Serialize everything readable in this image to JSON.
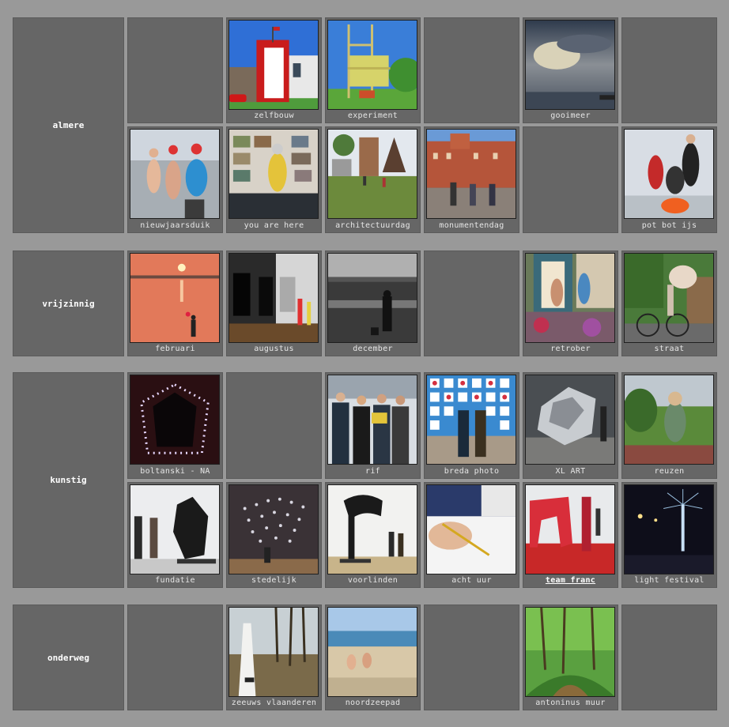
{
  "sections": [
    {
      "name": "almere"
    },
    {
      "name": "vrijzinnig"
    },
    {
      "name": "kunstig"
    },
    {
      "name": "onderweg"
    }
  ],
  "tiles": {
    "zelfbouw": "zelfbouw",
    "experiment": "experiment",
    "gooimeer": "gooimeer",
    "nieuwjaarsduik": "nieuwjaarsduik",
    "you_are_here": "you are here",
    "architectuurdag": "architectuurdag",
    "monumentendag": "monumentendag",
    "pot_bot_ijs": "pot bot ijs",
    "februari": "februari",
    "augustus": "augustus",
    "december": "december",
    "retrober": "retrober",
    "straat": "straat",
    "boltanski": "boltanski - NA",
    "rif": "rif",
    "breda_photo": "breda photo",
    "xl_art": "XL ART",
    "reuzen": "reuzen",
    "fundatie": "fundatie",
    "stedelijk": "stedelijk",
    "voorlinden": "voorlinden",
    "acht_uur": "acht uur",
    "team_franc": "team franc",
    "light_festival": "light festival",
    "zeeuws_vlaanderen": "zeeuws vlaanderen",
    "noordzeepad": "noordzeepad",
    "antoninus_muur": "antoninus muur"
  },
  "colors": {
    "page_background": "#999999",
    "cell_background": "#666666",
    "label_text": "#ffffff",
    "caption_text": "#e6e6e6"
  }
}
